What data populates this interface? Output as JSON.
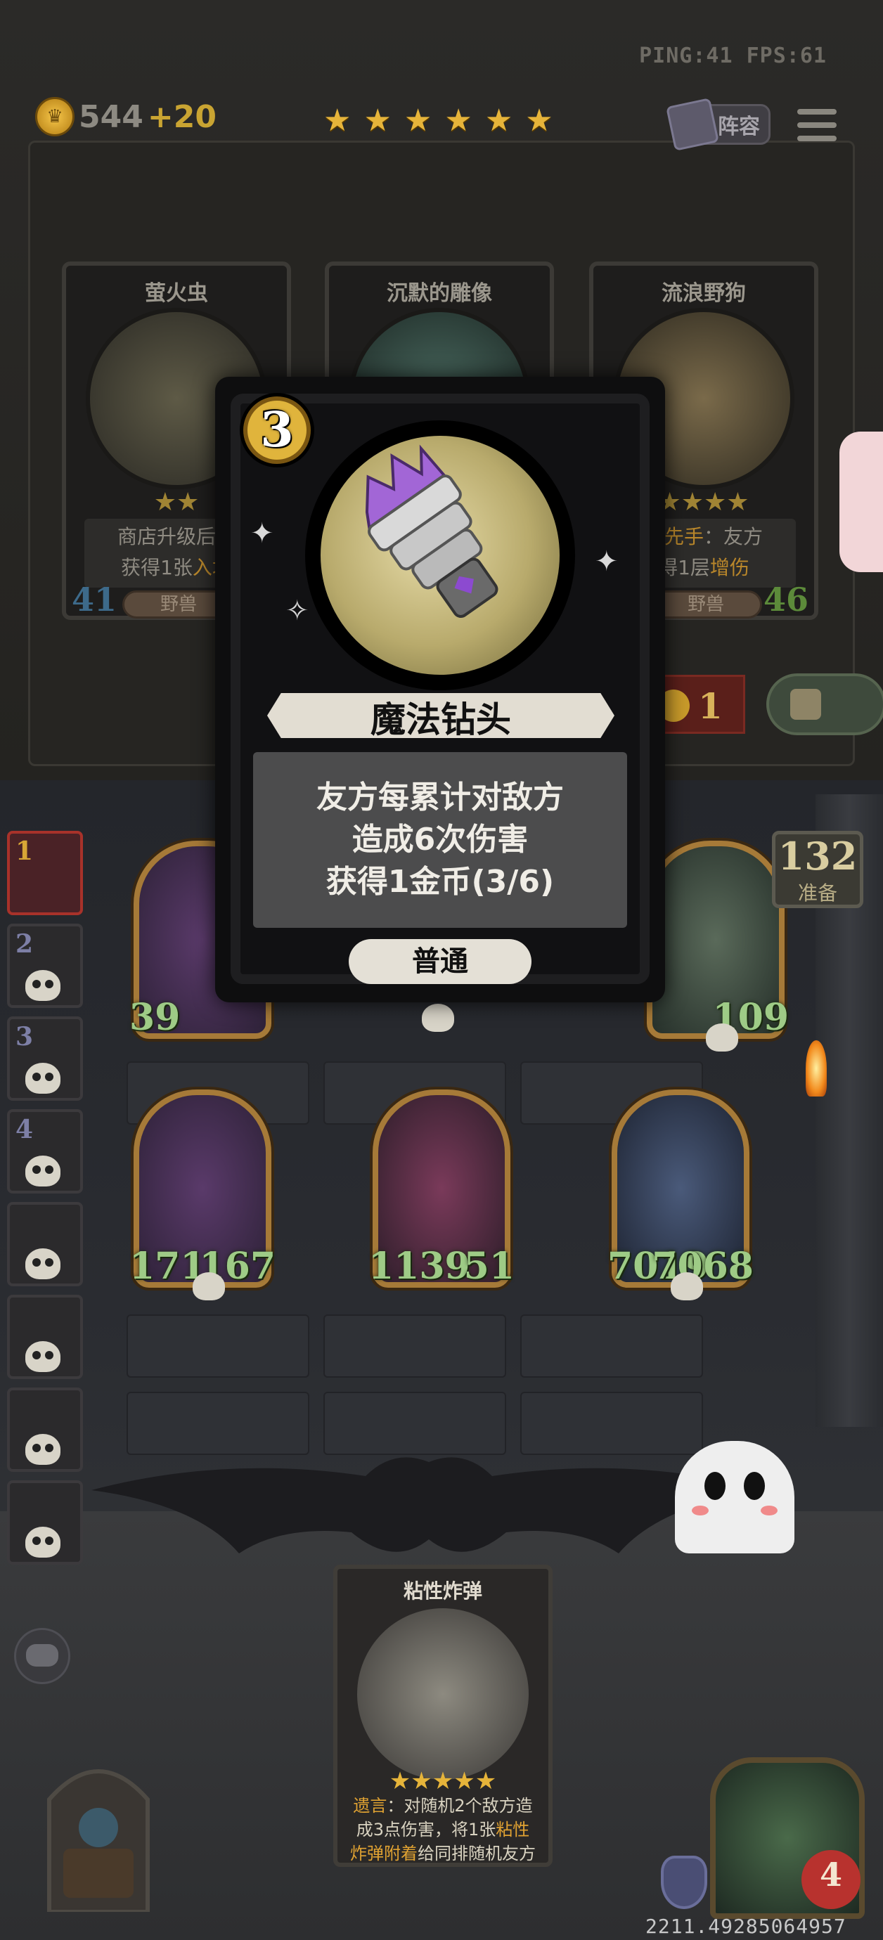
{
  "hud": {
    "ping_fps": "PING:41  FPS:61",
    "coins": "544",
    "coin_income": "+20",
    "tier_stars": 6,
    "lineup_label": "阵容"
  },
  "shop": {
    "cards": [
      {
        "name": "萤火虫",
        "stars": 2,
        "desc_line1": "商店升级后，",
        "desc_line2_pre": "获得1张",
        "desc_line2_hl": "入场",
        "tribe": "野兽",
        "attack": "41",
        "health": ""
      },
      {
        "name": "沉默的雕像",
        "stars": 0,
        "desc_line1": "",
        "desc_line2_pre": "",
        "desc_line2_hl": "",
        "tribe": "",
        "attack": "",
        "health": ""
      },
      {
        "name": "流浪野狗",
        "stars": 4,
        "desc_line1_pre": "，",
        "desc_line1_hl": "先手",
        "desc_line1_post": "：友方",
        "desc_line2_pre": "得1层",
        "desc_line2_hl": "增伤",
        "tribe": "野兽",
        "attack": "",
        "health": "46"
      }
    ],
    "freeze_value": "1"
  },
  "side_minions": [
    {
      "num": "1",
      "active": true
    },
    {
      "num": "2",
      "active": false
    },
    {
      "num": "3",
      "active": false
    },
    {
      "num": "4",
      "active": false
    },
    {
      "num": "",
      "active": false
    },
    {
      "num": "",
      "active": false
    },
    {
      "num": "",
      "active": false
    },
    {
      "num": "",
      "active": false
    }
  ],
  "board": {
    "row1": [
      {
        "attack": "39",
        "health": ""
      },
      {
        "attack": "",
        "health": "109"
      }
    ],
    "row2": [
      {
        "attack": "171",
        "health": "167"
      },
      {
        "attack": "1139",
        "health": "51"
      },
      {
        "attack": "7019",
        "health": "7068"
      }
    ]
  },
  "deck_counter": {
    "value": "132",
    "label": "准备"
  },
  "hand_card": {
    "name": "粘性炸弹",
    "stars": 5,
    "desc_kw1": "遗言",
    "desc_text1": "：对随机2个敌方造",
    "desc_text2": "成3点伤害，将1张",
    "desc_kw2": "粘性",
    "desc_kw3": "炸弹附着",
    "desc_text3": "给同排随机友方"
  },
  "hero": {
    "health": "4"
  },
  "coords_readout": "2211.49285064957",
  "popup": {
    "cost": "3",
    "title": "魔法钻头",
    "desc_lines": [
      "友方每累计对敌方",
      "造成6次伤害",
      "获得1金币(3/6)"
    ],
    "rarity": "普通"
  },
  "colors": {
    "gold": "#e6b43a",
    "health_green": "#9ecb86",
    "popup_bg": "#111113",
    "rarity_pill": "#e4e0d6"
  }
}
